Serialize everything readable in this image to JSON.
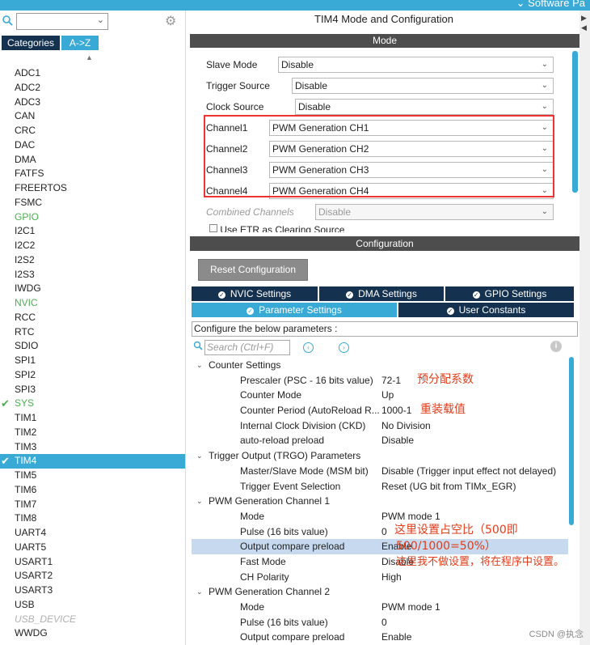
{
  "top": {
    "software_packs": "Software Pa"
  },
  "left": {
    "search_placeholder": "",
    "tabs": [
      "Categories",
      "A->Z"
    ],
    "items": [
      {
        "label": "ADC1",
        "state": ""
      },
      {
        "label": "ADC2",
        "state": ""
      },
      {
        "label": "ADC3",
        "state": ""
      },
      {
        "label": "CAN",
        "state": ""
      },
      {
        "label": "CRC",
        "state": ""
      },
      {
        "label": "DAC",
        "state": ""
      },
      {
        "label": "DMA",
        "state": ""
      },
      {
        "label": "FATFS",
        "state": ""
      },
      {
        "label": "FREERTOS",
        "state": ""
      },
      {
        "label": "FSMC",
        "state": ""
      },
      {
        "label": "GPIO",
        "state": "green"
      },
      {
        "label": "I2C1",
        "state": ""
      },
      {
        "label": "I2C2",
        "state": ""
      },
      {
        "label": "I2S2",
        "state": ""
      },
      {
        "label": "I2S3",
        "state": ""
      },
      {
        "label": "IWDG",
        "state": ""
      },
      {
        "label": "NVIC",
        "state": "green"
      },
      {
        "label": "RCC",
        "state": ""
      },
      {
        "label": "RTC",
        "state": ""
      },
      {
        "label": "SDIO",
        "state": ""
      },
      {
        "label": "SPI1",
        "state": ""
      },
      {
        "label": "SPI2",
        "state": ""
      },
      {
        "label": "SPI3",
        "state": ""
      },
      {
        "label": "SYS",
        "state": "green-check"
      },
      {
        "label": "TIM1",
        "state": ""
      },
      {
        "label": "TIM2",
        "state": ""
      },
      {
        "label": "TIM3",
        "state": ""
      },
      {
        "label": "TIM4",
        "state": "selected-check"
      },
      {
        "label": "TIM5",
        "state": ""
      },
      {
        "label": "TIM6",
        "state": ""
      },
      {
        "label": "TIM7",
        "state": ""
      },
      {
        "label": "TIM8",
        "state": ""
      },
      {
        "label": "UART4",
        "state": ""
      },
      {
        "label": "UART5",
        "state": ""
      },
      {
        "label": "USART1",
        "state": ""
      },
      {
        "label": "USART2",
        "state": ""
      },
      {
        "label": "USART3",
        "state": ""
      },
      {
        "label": "USB",
        "state": ""
      },
      {
        "label": "USB_DEVICE",
        "state": "disabled"
      },
      {
        "label": "WWDG",
        "state": ""
      }
    ]
  },
  "main": {
    "title": "TIM4 Mode and Configuration",
    "mode_header": "Mode",
    "mode_fields": [
      {
        "label": "Slave Mode",
        "value": "Disable"
      },
      {
        "label": "Trigger Source",
        "value": "Disable"
      },
      {
        "label": "Clock Source",
        "value": "Disable"
      },
      {
        "label": "Channel1",
        "value": "PWM Generation CH1"
      },
      {
        "label": "Channel2",
        "value": "PWM Generation CH2"
      },
      {
        "label": "Channel3",
        "value": "PWM Generation CH3"
      },
      {
        "label": "Channel4",
        "value": "PWM Generation CH4"
      },
      {
        "label": "Combined Channels",
        "value": "Disable"
      }
    ],
    "cut_off_checkbox": "Use ETR as Clearing Source",
    "config_header": "Configuration",
    "reset_button": "Reset Configuration",
    "tabs_row1": [
      "NVIC Settings",
      "DMA Settings",
      "GPIO Settings"
    ],
    "tabs_row2": [
      "Parameter Settings",
      "User Constants"
    ],
    "configure_text": "Configure the below parameters :",
    "search_placeholder": "Search (Ctrl+F)",
    "params": [
      {
        "type": "group",
        "label": "Counter Settings"
      },
      {
        "type": "item",
        "key": "Prescaler (PSC - 16 bits value)",
        "value": "72-1"
      },
      {
        "type": "item",
        "key": "Counter Mode",
        "value": "Up"
      },
      {
        "type": "item",
        "key": "Counter Period (AutoReload R...",
        "value": "1000-1"
      },
      {
        "type": "item",
        "key": "Internal Clock Division (CKD)",
        "value": "No Division"
      },
      {
        "type": "item",
        "key": "auto-reload preload",
        "value": "Disable"
      },
      {
        "type": "group",
        "label": "Trigger Output (TRGO) Parameters"
      },
      {
        "type": "item",
        "key": "Master/Slave Mode (MSM bit)",
        "value": "Disable (Trigger input effect not delayed)"
      },
      {
        "type": "item",
        "key": "Trigger Event Selection",
        "value": "Reset (UG bit from TIMx_EGR)"
      },
      {
        "type": "group",
        "label": "PWM Generation Channel 1"
      },
      {
        "type": "item",
        "key": "Mode",
        "value": "PWM mode 1"
      },
      {
        "type": "item",
        "key": "Pulse (16 bits value)",
        "value": "0"
      },
      {
        "type": "item",
        "key": "Output compare preload",
        "value": "Enable",
        "highlight": true
      },
      {
        "type": "item",
        "key": "Fast Mode",
        "value": "Disable"
      },
      {
        "type": "item",
        "key": "CH Polarity",
        "value": "High"
      },
      {
        "type": "group",
        "label": "PWM Generation Channel 2"
      },
      {
        "type": "item",
        "key": "Mode",
        "value": "PWM mode 1"
      },
      {
        "type": "item",
        "key": "Pulse (16 bits value)",
        "value": "0"
      },
      {
        "type": "item",
        "key": "Output compare preload",
        "value": "Enable"
      }
    ]
  },
  "annotations": {
    "prescaler_note": "预分配系数",
    "period_note": "重装载值",
    "duty_line1": "这里设置占空比（500即",
    "duty_line2": "500/1000=50%）",
    "duty_line3": "这里我不做设置，将在程序中设置。"
  },
  "watermark": "CSDN @执念",
  "colors": {
    "accent": "#39a9d6",
    "dark_tab": "#14324f",
    "header_bar": "#4d4d4d",
    "annotation": "#e23c1a",
    "highlight_box": "#ee3333"
  }
}
